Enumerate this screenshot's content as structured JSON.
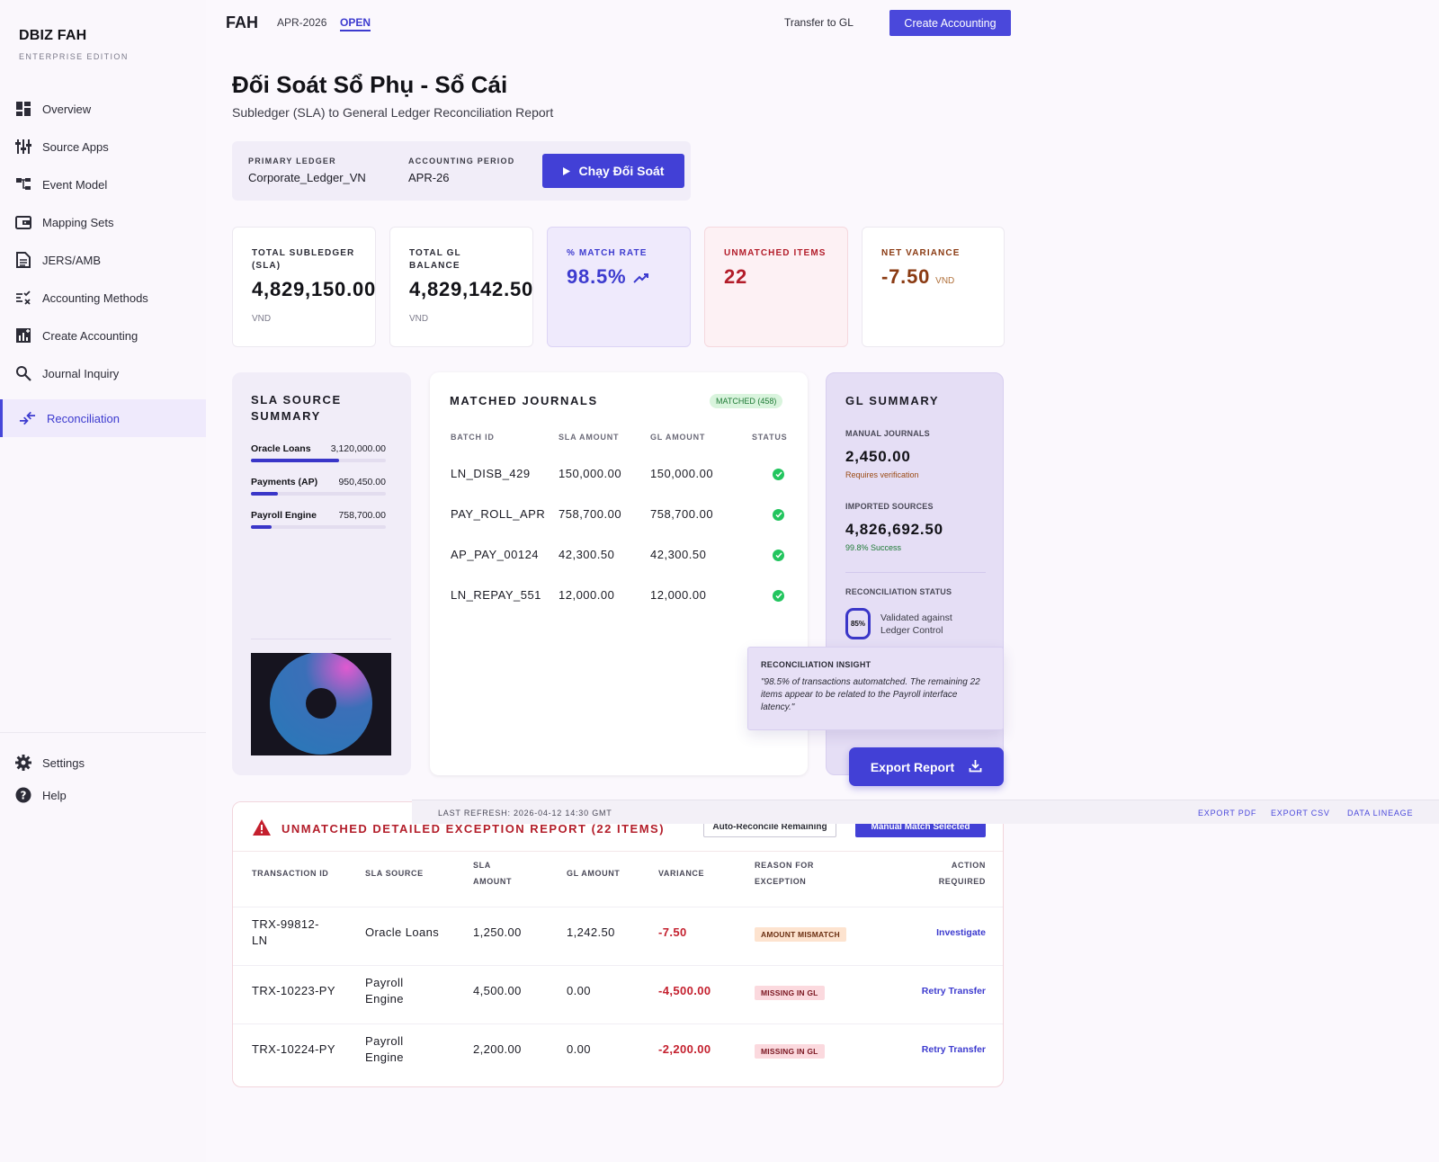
{
  "brand": {
    "name": "DBIZ FAH",
    "edition": "ENTERPRISE EDITION"
  },
  "sidebar": {
    "items": [
      {
        "label": "Overview",
        "icon": "dashboard-icon"
      },
      {
        "label": "Source Apps",
        "icon": "sliders-icon"
      },
      {
        "label": "Event Model",
        "icon": "tree-icon"
      },
      {
        "label": "Mapping Sets",
        "icon": "wallet-icon"
      },
      {
        "label": "JERS/AMB",
        "icon": "document-icon"
      },
      {
        "label": "Accounting Methods",
        "icon": "rule-icon"
      },
      {
        "label": "Create Accounting",
        "icon": "chart-add-icon"
      },
      {
        "label": "Journal Inquiry",
        "icon": "search-icon"
      },
      {
        "label": "Reconciliation",
        "icon": "compare-icon",
        "active": true
      }
    ],
    "bottom": [
      {
        "label": "Settings",
        "icon": "gear-icon"
      },
      {
        "label": "Help",
        "icon": "help-icon"
      }
    ]
  },
  "topbar": {
    "app": "FAH",
    "period": "APR-2026",
    "status": "OPEN",
    "transfer_label": "Transfer to GL",
    "create_label": "Create Accounting"
  },
  "header": {
    "title": "Đối Soát Sổ Phụ - Sổ Cái",
    "subtitle": "Subledger (SLA) to General Ledger Reconciliation Report"
  },
  "filters": {
    "ledger_label": "PRIMARY LEDGER",
    "ledger_value": "Corporate_Ledger_VN",
    "period_label": "ACCOUNTING PERIOD",
    "period_value": "APR-26",
    "run_label": "Chạy Đối Soát"
  },
  "kpis": {
    "sla": {
      "label": "TOTAL SUBLEDGER (SLA)",
      "value": "4,829,150.00",
      "unit": "VND"
    },
    "gl": {
      "label": "TOTAL GL BALANCE",
      "value": "4,829,142.50",
      "unit": "VND"
    },
    "match": {
      "label": "% MATCH RATE",
      "value": "98.5%"
    },
    "unmatched": {
      "label": "UNMATCHED ITEMS",
      "value": "22"
    },
    "variance": {
      "label": "NET VARIANCE",
      "value": "-7.50",
      "unit": "VND"
    }
  },
  "sla_summary": {
    "title": "SLA SOURCE SUMMARY",
    "rows": [
      {
        "name": "Oracle Loans",
        "amount": "3,120,000.00",
        "share": 0.65
      },
      {
        "name": "Payments (AP)",
        "amount": "950,450.00",
        "share": 0.2
      },
      {
        "name": "Payroll Engine",
        "amount": "758,700.00",
        "share": 0.15
      }
    ]
  },
  "matched": {
    "title": "MATCHED JOURNALS",
    "badge": "MATCHED (458)",
    "headers": [
      "BATCH ID",
      "SLA AMOUNT",
      "GL AMOUNT",
      "STATUS"
    ],
    "rows": [
      {
        "batch": "LN_DISB_429",
        "sla": "150,000.00",
        "gl": "150,000.00"
      },
      {
        "batch": "PAY_ROLL_APR",
        "sla": "758,700.00",
        "gl": "758,700.00"
      },
      {
        "batch": "AP_PAY_00124",
        "sla": "42,300.50",
        "gl": "42,300.50"
      },
      {
        "batch": "LN_REPAY_551",
        "sla": "12,000.00",
        "gl": "12,000.00"
      }
    ]
  },
  "gl_summary": {
    "title": "GL SUMMARY",
    "manual_label": "MANUAL JOURNALS",
    "manual_value": "2,450.00",
    "manual_note": "Requires verification",
    "imported_label": "IMPORTED SOURCES",
    "imported_value": "4,826,692.50",
    "imported_note": "99.8% Success",
    "status_label": "RECONCILIATION STATUS",
    "status_pct": "85%",
    "status_text_1": "Validated against",
    "status_text_2": "Ledger Control"
  },
  "insight": {
    "title": "RECONCILIATION INSIGHT",
    "text": "\"98.5% of transactions automatched. The remaining 22 items appear to be related to the Payroll interface latency.\""
  },
  "export_label": "Export Report",
  "footer": {
    "refresh": "LAST REFRESH: 2026-04-12 14:30 GMT",
    "pdf": "EXPORT PDF",
    "csv": "EXPORT CSV",
    "lineage": "DATA LINEAGE"
  },
  "exceptions": {
    "title": "UNMATCHED DETAILED EXCEPTION REPORT (22 ITEMS)",
    "auto_label": "Auto-Reconcile Remaining",
    "manual_label": "Manual Match Selected",
    "headers": {
      "txn": "TRANSACTION ID",
      "source": "SLA SOURCE",
      "sla_1": "SLA",
      "sla_2": "AMOUNT",
      "gl": "GL AMOUNT",
      "variance": "VARIANCE",
      "reason_1": "REASON FOR",
      "reason_2": "EXCEPTION",
      "action_1": "ACTION",
      "action_2": "REQUIRED"
    },
    "rows": [
      {
        "txn_1": "TRX-99812-",
        "txn_2": "LN",
        "source_1": "Oracle Loans",
        "source_2": "",
        "sla": "1,250.00",
        "gl": "1,242.50",
        "variance": "-7.50",
        "reason": "AMOUNT MISMATCH",
        "action": "Investigate"
      },
      {
        "txn_1": "TRX-10223-PY",
        "txn_2": "",
        "source_1": "Payroll",
        "source_2": "Engine",
        "sla": "4,500.00",
        "gl": "0.00",
        "variance": "-4,500.00",
        "reason": "MISSING IN GL",
        "action": "Retry Transfer"
      },
      {
        "txn_1": "TRX-10224-PY",
        "txn_2": "",
        "source_1": "Payroll",
        "source_2": "Engine",
        "sla": "2,200.00",
        "gl": "0.00",
        "variance": "-2,200.00",
        "reason": "MISSING IN GL",
        "action": "Retry Transfer"
      }
    ]
  }
}
